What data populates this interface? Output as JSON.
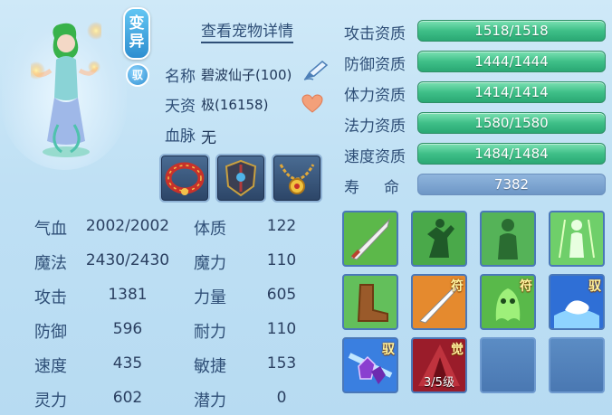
{
  "pet": {
    "variant_badge": "变异",
    "bond_badge": "驭",
    "details_link": "查看宠物详情",
    "name_label": "名称",
    "name_value": "碧波仙子(100)",
    "talent_label": "天资",
    "talent_value": "极(16158)",
    "bloodline_label": "血脉",
    "bloodline_value": "无"
  },
  "equipment": [
    {
      "icon": "red-collar-icon"
    },
    {
      "icon": "armor-icon"
    },
    {
      "icon": "gold-necklace-icon"
    }
  ],
  "aptitudes": [
    {
      "label": "攻击资质",
      "value": "1518/1518"
    },
    {
      "label": "防御资质",
      "value": "1444/1444"
    },
    {
      "label": "体力资质",
      "value": "1414/1414"
    },
    {
      "label": "法力资质",
      "value": "1580/1580"
    },
    {
      "label": "速度资质",
      "value": "1484/1484"
    }
  ],
  "lifespan": {
    "label_a": "寿",
    "label_b": "命",
    "value": "7382"
  },
  "stats_left": [
    {
      "label": "气血",
      "value": "2002/2002"
    },
    {
      "label": "魔法",
      "value": "2430/2430"
    },
    {
      "label": "攻击",
      "value": "1381"
    },
    {
      "label": "防御",
      "value": "596"
    },
    {
      "label": "速度",
      "value": "435"
    },
    {
      "label": "灵力",
      "value": "602"
    }
  ],
  "stats_right": [
    {
      "label": "体质",
      "value": "122"
    },
    {
      "label": "魔力",
      "value": "110"
    },
    {
      "label": "力量",
      "value": "605"
    },
    {
      "label": "耐力",
      "value": "110"
    },
    {
      "label": "敏捷",
      "value": "153"
    },
    {
      "label": "潜力",
      "value": "0"
    }
  ],
  "skills": [
    {
      "icon": "sword-strike-icon",
      "tag": "",
      "level": ""
    },
    {
      "icon": "shadow-fighter-icon",
      "tag": "",
      "level": ""
    },
    {
      "icon": "green-silhouette-icon",
      "tag": "",
      "level": ""
    },
    {
      "icon": "green-aura-icon",
      "tag": "",
      "level": ""
    },
    {
      "icon": "boot-icon",
      "tag": "",
      "level": ""
    },
    {
      "icon": "sword-rune-icon",
      "tag": "符",
      "level": ""
    },
    {
      "icon": "green-ghost-icon",
      "tag": "符",
      "level": ""
    },
    {
      "icon": "water-lamp-icon",
      "tag": "驭",
      "level": ""
    },
    {
      "icon": "purple-crystal-icon",
      "tag": "驭",
      "level": ""
    },
    {
      "icon": "red-awaken-icon",
      "tag": "觉",
      "level": "3/5级"
    },
    {
      "icon": "empty-slot",
      "tag": "",
      "level": ""
    },
    {
      "icon": "empty-slot",
      "tag": "",
      "level": ""
    }
  ],
  "colors": {
    "aptitude_bar": "#3fbf88",
    "lifespan_bar": "#7ea6d3",
    "label_text": "#2f4f77"
  }
}
